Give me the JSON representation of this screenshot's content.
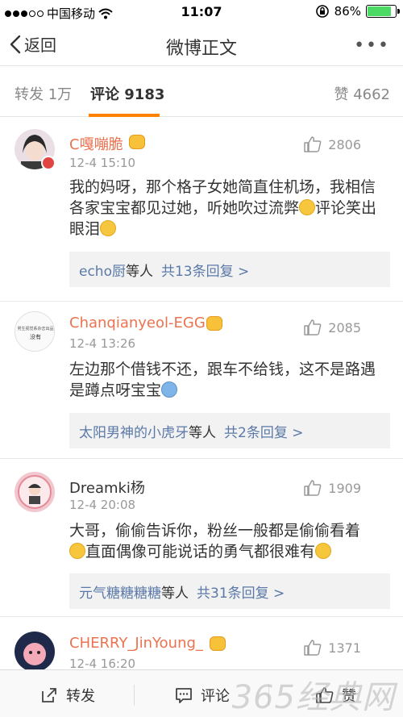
{
  "status_bar": {
    "carrier": "中国移动",
    "time": "11:07",
    "battery": "86%",
    "battery_level": 0.86
  },
  "nav": {
    "back_label": "返回",
    "title": "微博正文",
    "more_label": "•••"
  },
  "tabs": {
    "repost": "转发 1万",
    "comment": "评论 9183",
    "like": "赞 4662"
  },
  "comments": [
    {
      "name": "C嘎嘣脆",
      "time": "12-4 15:10",
      "likes": "2806",
      "text_1": "我的妈呀，那个格子女她简直住机场，我相信各家宝宝都见过她，听她吹过流弊",
      "text_2": "评论笑出眼泪",
      "reply_users": "echo厨",
      "reply_mid": "等人",
      "reply_count": "共13条回复 >"
    },
    {
      "name": "Chanqianyeol-EGG",
      "time": "12-4 13:26",
      "likes": "2085",
      "text_1": "左边那个借钱不还，跟车不给钱，这不是路遇是蹲点呀宝宝",
      "avatar_text_1": "男生视觉系杂志出品",
      "avatar_text_2": "没有",
      "reply_users": "太阳男神的小虎牙",
      "reply_mid": "等人",
      "reply_count": "共2条回复 >"
    },
    {
      "name": "Dreamki杨",
      "time": "12-4 20:08",
      "likes": "1909",
      "text_1": "大哥，偷偷告诉你，粉丝一般都是偷偷看着",
      "text_2": "直面偶像可能说话的勇气都很难有",
      "reply_users": "元气糖糖糖糖",
      "reply_mid": "等人",
      "reply_count": "共31条回复 >"
    },
    {
      "name": "CHERRY_JinYoung_",
      "time": "12-4 16:20",
      "likes": "1371"
    }
  ],
  "bottom_bar": {
    "repost": "转发",
    "comment": "评论",
    "like": "赞"
  },
  "watermark": "365经典网",
  "colors": {
    "accent": "#ff8200",
    "name": "#eb7350",
    "link": "#5b79a8"
  }
}
